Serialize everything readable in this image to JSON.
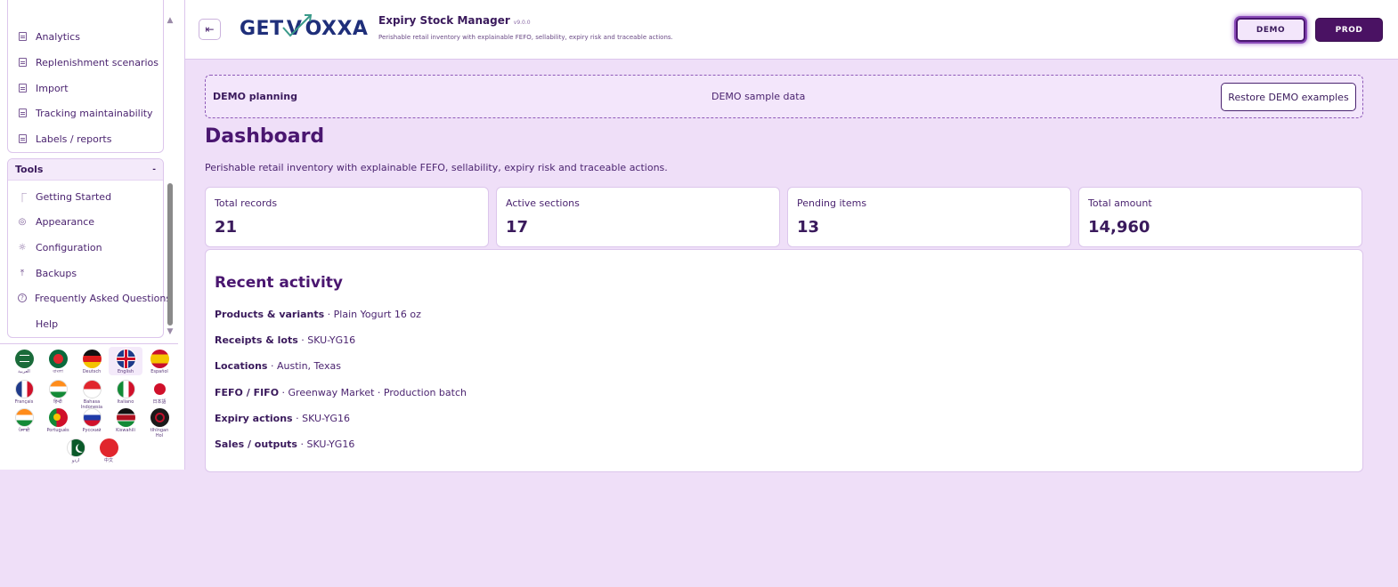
{
  "sidebar": {
    "top_items": [
      {
        "label": "Analytics"
      },
      {
        "label": "Replenishment scenarios"
      },
      {
        "label": "Import"
      },
      {
        "label": "Tracking maintainability"
      },
      {
        "label": "Labels / reports"
      }
    ],
    "tools": {
      "title": "Tools",
      "collapse_glyph": "-",
      "items": [
        {
          "label": "Getting Started",
          "icon": "rocket-icon",
          "glyph": "⎾"
        },
        {
          "label": "Appearance",
          "icon": "palette-icon",
          "glyph": "◎"
        },
        {
          "label": "Configuration",
          "icon": "gear-icon",
          "glyph": "☼"
        },
        {
          "label": "Backups",
          "icon": "upload-icon",
          "glyph": "⤒"
        },
        {
          "label": "Frequently Asked Questions",
          "icon": "question-icon",
          "glyph": "?"
        },
        {
          "label": "Help",
          "icon": "",
          "glyph": ""
        }
      ]
    },
    "languages": [
      {
        "label": "العربية",
        "code": "ar"
      },
      {
        "label": "বাংলা",
        "code": "bn"
      },
      {
        "label": "Deutsch",
        "code": "de"
      },
      {
        "label": "English",
        "code": "en",
        "selected": true
      },
      {
        "label": "Español",
        "code": "es"
      },
      {
        "label": "Français",
        "code": "fr"
      },
      {
        "label": "हिन्दी",
        "code": "hi"
      },
      {
        "label": "Bahasa Indonesia",
        "code": "id"
      },
      {
        "label": "Italiano",
        "code": "it"
      },
      {
        "label": "日本語",
        "code": "ja"
      },
      {
        "label": "ਪੰਜਾਬੀ",
        "code": "pa"
      },
      {
        "label": "Português",
        "code": "pt"
      },
      {
        "label": "Русский",
        "code": "ru"
      },
      {
        "label": "Kiswahili",
        "code": "sw"
      },
      {
        "label": "tlhIngan Hol",
        "code": "tlh"
      },
      {
        "label": "اردو",
        "code": "ur"
      },
      {
        "label": "中文",
        "code": "zh"
      }
    ]
  },
  "header": {
    "toggle_glyph": "⇤",
    "logo_text_left": "GET",
    "logo_text_right": "OXXA",
    "app_title": "Expiry Stock Manager",
    "version": "v9.0.0",
    "subtitle": "Perishable retail inventory with explainable FEFO, sellability, expiry risk and traceable actions.",
    "mode_demo": "DEMO",
    "mode_prod": "PROD"
  },
  "demo_bar": {
    "left": "DEMO planning",
    "middle": "DEMO sample data",
    "restore": "Restore DEMO examples"
  },
  "page": {
    "title": "Dashboard",
    "description": "Perishable retail inventory with explainable FEFO, sellability, expiry risk and traceable actions."
  },
  "kpis": [
    {
      "label": "Total records",
      "value": "21"
    },
    {
      "label": "Active sections",
      "value": "17"
    },
    {
      "label": "Pending items",
      "value": "13"
    },
    {
      "label": "Total amount",
      "value": "14,960"
    }
  ],
  "activity": {
    "title": "Recent activity",
    "rows": [
      {
        "section": "Products & variants",
        "detail": " · Plain Yogurt 16 oz"
      },
      {
        "section": "Receipts & lots",
        "detail": " · SKU-YG16"
      },
      {
        "section": "Locations",
        "detail": " · Austin, Texas"
      },
      {
        "section": "FEFO / FIFO",
        "detail": " · Greenway Market · Production batch"
      },
      {
        "section": "Expiry actions",
        "detail": " · SKU-YG16"
      },
      {
        "section": "Sales / outputs",
        "detail": " · SKU-YG16"
      }
    ]
  },
  "colors": {
    "accent": "#4a1670",
    "background": "#efdff8",
    "prod_button": "#4a1263"
  }
}
